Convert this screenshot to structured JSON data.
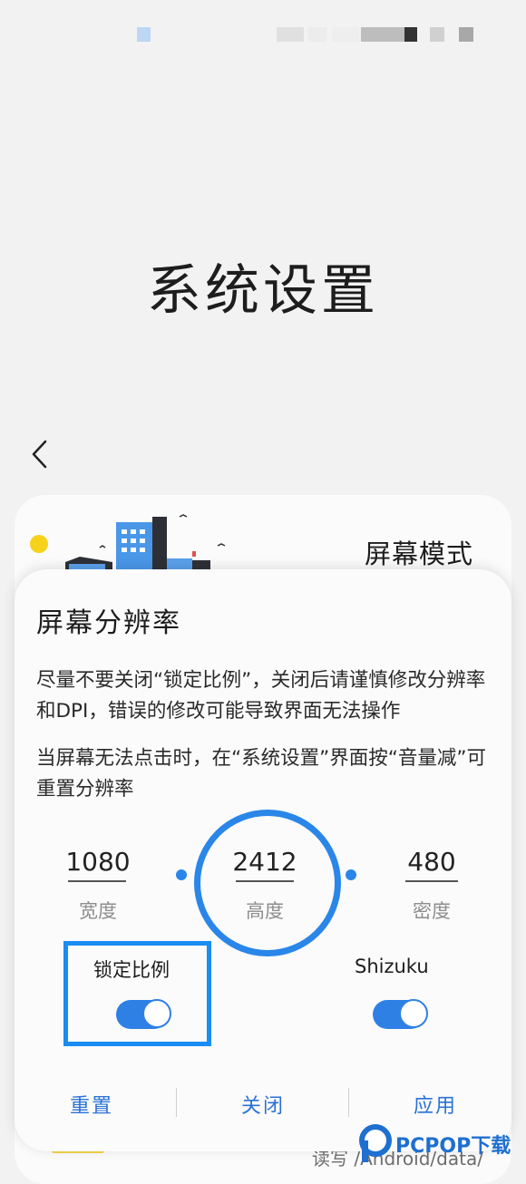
{
  "page": {
    "title": "系统设置"
  },
  "background_card": {
    "title": "屏幕模式",
    "bottom_text": "读写 /Android/data/"
  },
  "dialog": {
    "title": "屏幕分辨率",
    "paragraph1": "尽量不要关闭“锁定比例”，关闭后请谨慎修改分辨率和DPI，错误的修改可能导致界面无法操作",
    "paragraph2": "当屏幕无法点击时，在“系统设置”界面按“音量减”可重置分辨率",
    "fields": {
      "width": {
        "value": "1080",
        "label": "宽度"
      },
      "height": {
        "value": "2412",
        "label": "高度"
      },
      "density": {
        "value": "480",
        "label": "密度"
      }
    },
    "toggles": {
      "lock_ratio": {
        "label": "锁定比例",
        "on": true
      },
      "shizuku": {
        "label": "Shizuku",
        "on": true
      }
    },
    "buttons": {
      "reset": "重置",
      "close": "关闭",
      "apply": "应用"
    }
  },
  "watermark": {
    "text": "PCPOP下载"
  },
  "colors": {
    "accent": "#2a86e8",
    "highlight_box": "#1a8cf2",
    "button_text": "#2b72d6"
  },
  "icons": {
    "back": "chevron-left-icon"
  }
}
